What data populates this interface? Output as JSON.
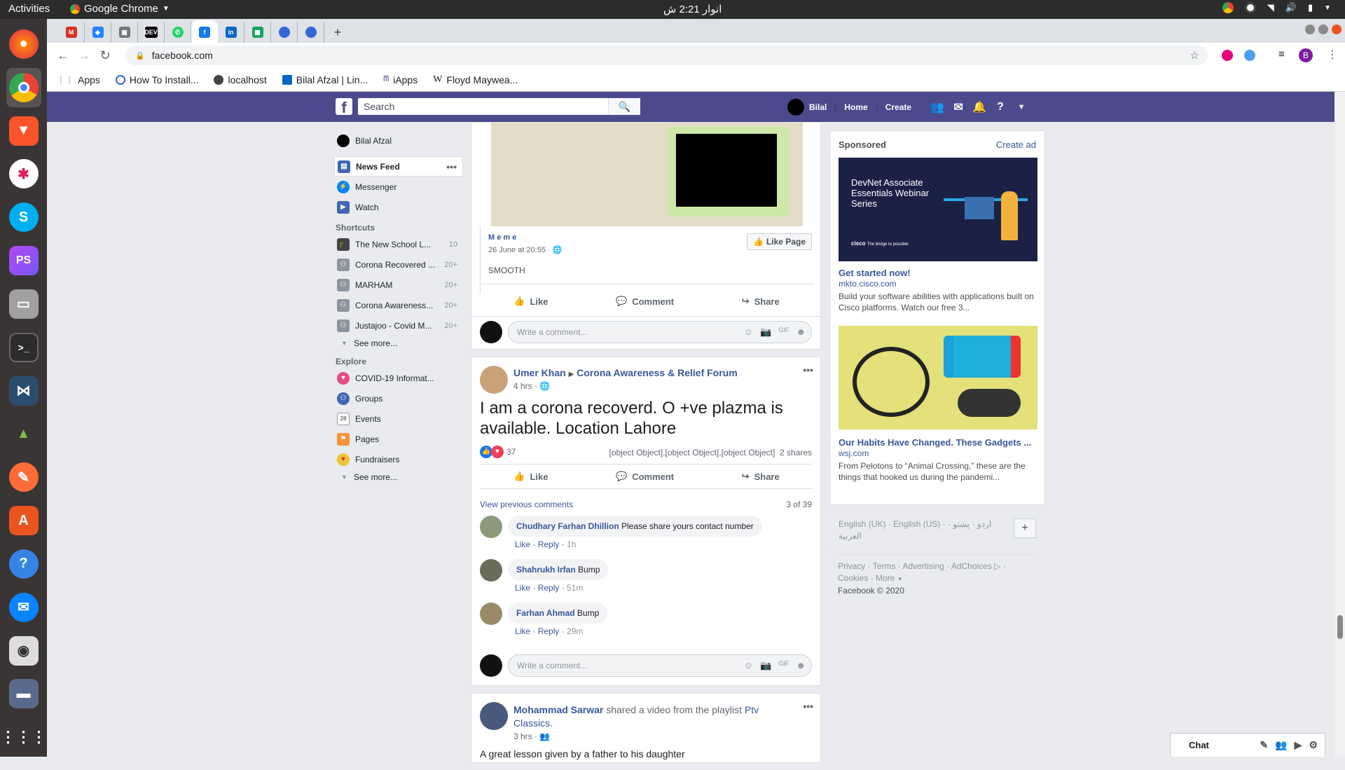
{
  "os": {
    "activities": "Activities",
    "app_name": "Google Chrome",
    "clock": "انوار 2:21 ش"
  },
  "dock": {
    "items": [
      "firefox-icon",
      "chrome-icon",
      "brave-icon",
      "slack-icon",
      "skype-icon",
      "phpstorm-icon",
      "files-icon",
      "terminal-icon",
      "mysql-workbench-icon",
      "rocket-icon",
      "postman-icon",
      "software-center-icon",
      "help-icon",
      "thunderbird-icon",
      "rhythmbox-icon",
      "screenshot-icon",
      "show-apps-icon"
    ]
  },
  "browser": {
    "url": "facebook.com",
    "profile_letter": "B",
    "bookmarks": [
      "Apps",
      "How To Install...",
      "localhost",
      "Bilal Afzal | Lin...",
      "iApps",
      "Floyd Maywea..."
    ]
  },
  "fb": {
    "search_placeholder": "Search",
    "user": "Bilal",
    "home": "Home",
    "create": "Create"
  },
  "left": {
    "profile": "Bilal Afzal",
    "main": [
      {
        "label": "News Feed"
      },
      {
        "label": "Messenger"
      },
      {
        "label": "Watch"
      }
    ],
    "shortcuts_title": "Shortcuts",
    "shortcuts": [
      {
        "label": "The New School L...",
        "count": "10"
      },
      {
        "label": "Corona Recovered ...",
        "count": "20+"
      },
      {
        "label": "MARHAM",
        "count": "20+"
      },
      {
        "label": "Corona Awareness...",
        "count": "20+"
      },
      {
        "label": "Justajoo - Covid M...",
        "count": "20+"
      }
    ],
    "see_more": "See more...",
    "explore_title": "Explore",
    "explore": [
      {
        "label": "COVID-19 Informat..."
      },
      {
        "label": "Groups"
      },
      {
        "label": "Events"
      },
      {
        "label": "Pages"
      },
      {
        "label": "Fundraisers"
      }
    ],
    "see_more2": "See more..."
  },
  "post1": {
    "page": "M e m e",
    "date": "26 June at 20:55 ·",
    "like_page": "Like Page",
    "text": "SMOOTH",
    "like": "Like",
    "comment": "Comment",
    "share": "Share",
    "write": "Write a comment..."
  },
  "post2": {
    "author": "Umer Khan",
    "group": "Corona Awareness & Relief Forum",
    "time": "4 hrs ·",
    "text": "I am a corona recoverd. O +ve plazma is available. Location Lahore",
    "reactions": "37",
    "comments": [
      {
        "name": "Chudhary Farhan Dhillion",
        "text": "Please share yours contact number",
        "time": "1h"
      },
      {
        "name": "Shahrukh Irfan",
        "text": "Bump",
        "time": "51m"
      },
      {
        "name": "Farhan Ahmad",
        "text": "Bump",
        "time": "29m"
      }
    ],
    "shares": "2 shares",
    "like": "Like",
    "comment": "Comment",
    "share": "Share",
    "view_prev": "View previous comments",
    "count": "3 of 39",
    "like_link": "Like",
    "reply_link": "Reply",
    "write": "Write a comment..."
  },
  "post3": {
    "author": "Mohammad Sarwar",
    "action": "shared a video from the playlist",
    "playlist": "Ptv Classics.",
    "time": "3 hrs ·",
    "text": "A great lesson given by a father to his daughter"
  },
  "right": {
    "sponsored": "Sponsored",
    "create_ad": "Create ad",
    "ad1": {
      "banner_text": "DevNet Associate Essentials Webinar Series",
      "brand": "cisco",
      "tagline": "The bridge to possible",
      "title": "Get started now!",
      "domain": "mkto.cisco.com",
      "desc": "Build your software abilities with applications built on Cisco platforms. Watch our free 3..."
    },
    "ad2": {
      "title": "Our Habits Have Changed. These Gadgets ...",
      "domain": "wsj.com",
      "desc": "From Pelotons to “Animal Crossing,” these are the things that hooked us during the pandemi..."
    },
    "languages": "English (UK) · English (US) · اردو · پښتو · العربية",
    "footer1": "Privacy · Terms · Advertising · AdChoices",
    "footer2": "Cookies · More",
    "copyright": "Facebook © 2020"
  },
  "chat": {
    "label": "Chat"
  }
}
